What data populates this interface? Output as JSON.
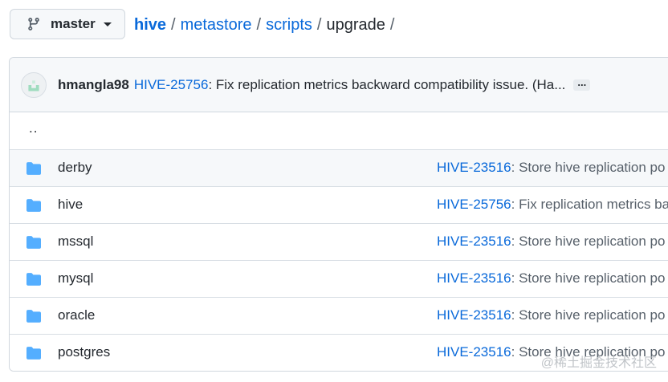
{
  "branch": {
    "label": "master",
    "icon": "git-branch-icon"
  },
  "breadcrumb": {
    "repo": "hive",
    "parts": [
      "metastore",
      "scripts"
    ],
    "current": "upgrade",
    "separator": "/"
  },
  "latest_commit": {
    "author": "hmangla98",
    "id": "HIVE-25756",
    "message": ": Fix replication metrics backward compatibility issue. (Ha...",
    "expand_label": "..."
  },
  "parent_link": "..",
  "entries": [
    {
      "name": "derby",
      "commit_id": "HIVE-23516",
      "commit_msg": ": Store hive replication po"
    },
    {
      "name": "hive",
      "commit_id": "HIVE-25756",
      "commit_msg": ": Fix replication metrics ba"
    },
    {
      "name": "mssql",
      "commit_id": "HIVE-23516",
      "commit_msg": ": Store hive replication po"
    },
    {
      "name": "mysql",
      "commit_id": "HIVE-23516",
      "commit_msg": ": Store hive replication po"
    },
    {
      "name": "oracle",
      "commit_id": "HIVE-23516",
      "commit_msg": ": Store hive replication po"
    },
    {
      "name": "postgres",
      "commit_id": "HIVE-23516",
      "commit_msg": ": Store hive replication po"
    }
  ],
  "watermark": "@稀土掘金技术社区",
  "colors": {
    "link": "#0969da",
    "folder": "#54aeff",
    "border": "#d0d7de",
    "header_bg": "#f6f8fa"
  }
}
